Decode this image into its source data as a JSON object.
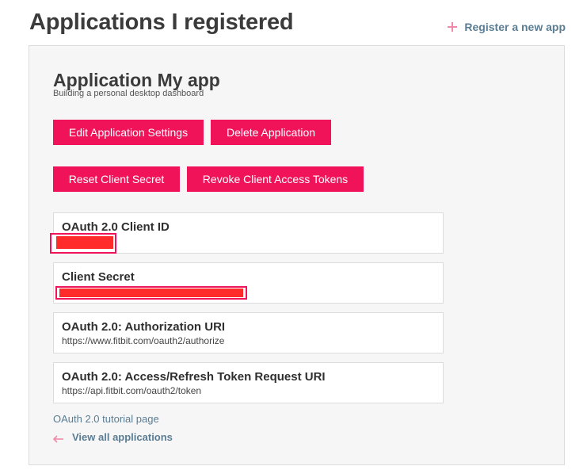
{
  "header": {
    "title": "Applications I registered",
    "register_link": "Register a new app"
  },
  "app": {
    "title": "Application My app",
    "description": "Building a personal desktop dashboard"
  },
  "buttons": {
    "edit": "Edit Application Settings",
    "delete": "Delete Application",
    "reset": "Reset Client Secret",
    "revoke": "Revoke Client Access Tokens"
  },
  "cards": [
    {
      "title": "OAuth 2.0 Client ID",
      "value": ""
    },
    {
      "title": "Client Secret",
      "value": ""
    },
    {
      "title": "OAuth 2.0: Authorization URI",
      "value": "https://www.fitbit.com/oauth2/authorize"
    },
    {
      "title": "OAuth 2.0: Access/Refresh Token Request URI",
      "value": "https://api.fitbit.com/oauth2/token"
    }
  ],
  "footer": {
    "tutorial": "OAuth 2.0 tutorial page",
    "view_all": "View all applications"
  },
  "colors": {
    "accent": "#f0135a",
    "link": "#5b7d93",
    "redaction": "#ff2a2a"
  },
  "icons": {
    "register": "plus-icon",
    "view_all": "back-arrow-icon"
  }
}
